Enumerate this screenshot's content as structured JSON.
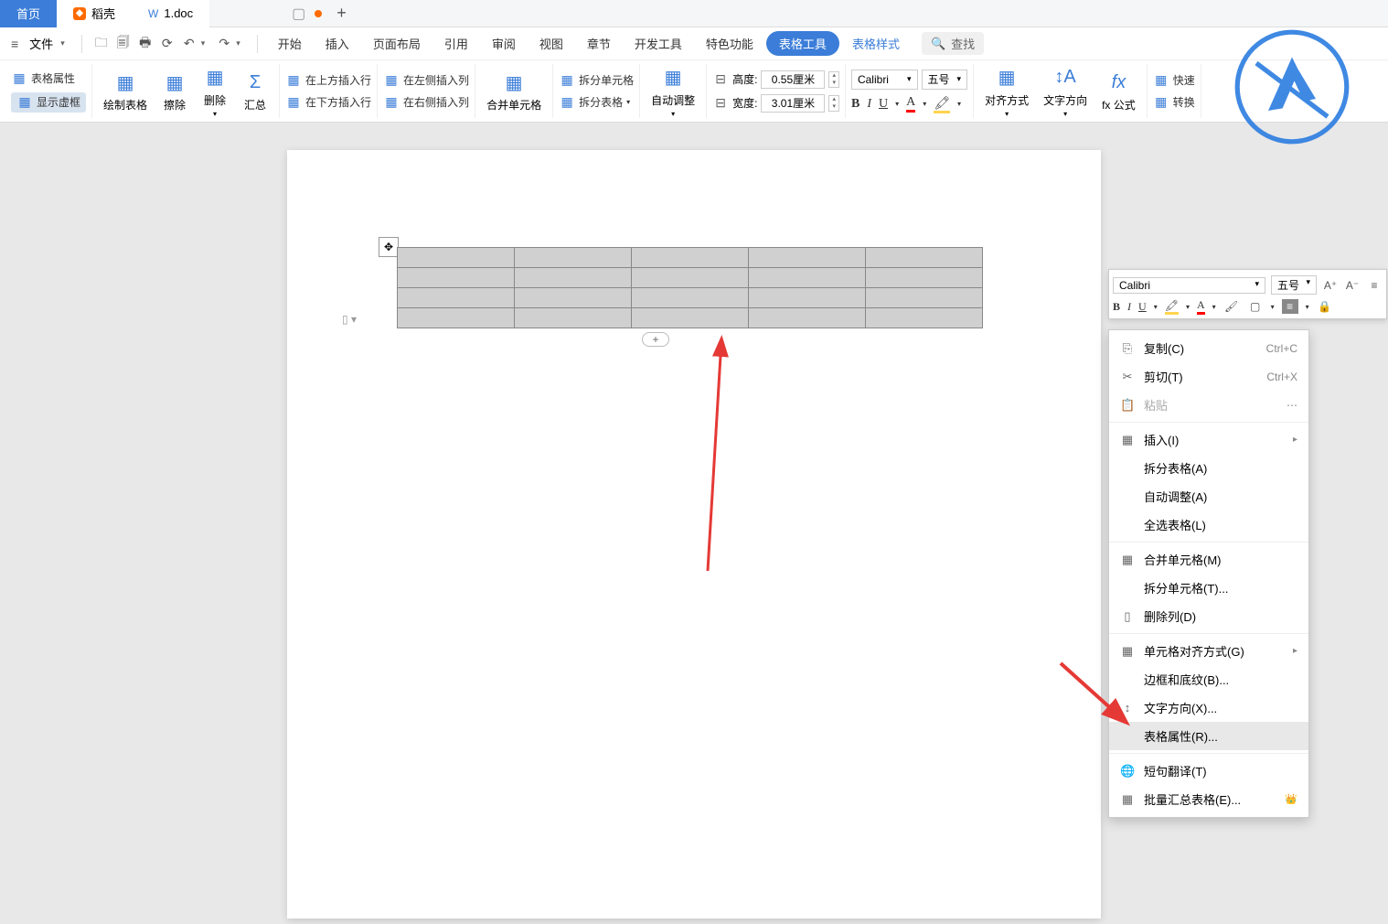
{
  "tabs": {
    "home": "首页",
    "daoke": "稻壳",
    "doc": "1.doc"
  },
  "file_menu": "文件",
  "main_menu": [
    "开始",
    "插入",
    "页面布局",
    "引用",
    "审阅",
    "视图",
    "章节",
    "开发工具",
    "特色功能"
  ],
  "table_tools": "表格工具",
  "table_style": "表格样式",
  "search": "查找",
  "ribbon": {
    "props": "表格属性",
    "show_virtual": "显示虚框",
    "draw": "绘制表格",
    "eraser": "擦除",
    "delete": "删除",
    "summary": "汇总",
    "ins_above": "在上方插入行",
    "ins_below": "在下方插入行",
    "ins_left": "在左侧插入列",
    "ins_right": "在右侧插入列",
    "merge": "合并单元格",
    "split_cell": "拆分单元格",
    "split_table": "拆分表格",
    "autofit": "自动调整",
    "height_lbl": "高度:",
    "width_lbl": "宽度:",
    "height_val": "0.55厘米",
    "width_val": "3.01厘米",
    "font_name": "Calibri",
    "font_size": "五号",
    "align": "对齐方式",
    "text_dir": "文字方向",
    "formula": "fx 公式",
    "quick": "快速",
    "convert": "转换"
  },
  "mini": {
    "font": "Calibri",
    "size": "五号"
  },
  "ctx": {
    "copy": "复制(C)",
    "copy_k": "Ctrl+C",
    "cut": "剪切(T)",
    "cut_k": "Ctrl+X",
    "paste": "粘贴",
    "insert": "插入(I)",
    "split_tbl": "拆分表格(A)",
    "autofit": "自动调整(A)",
    "select_all": "全选表格(L)",
    "merge": "合并单元格(M)",
    "split_cell": "拆分单元格(T)...",
    "del_col": "删除列(D)",
    "cell_align": "单元格对齐方式(G)",
    "border": "边框和底纹(B)...",
    "text_dir": "文字方向(X)...",
    "tbl_props": "表格属性(R)...",
    "translate": "短句翻译(T)",
    "batch": "批量汇总表格(E)..."
  }
}
